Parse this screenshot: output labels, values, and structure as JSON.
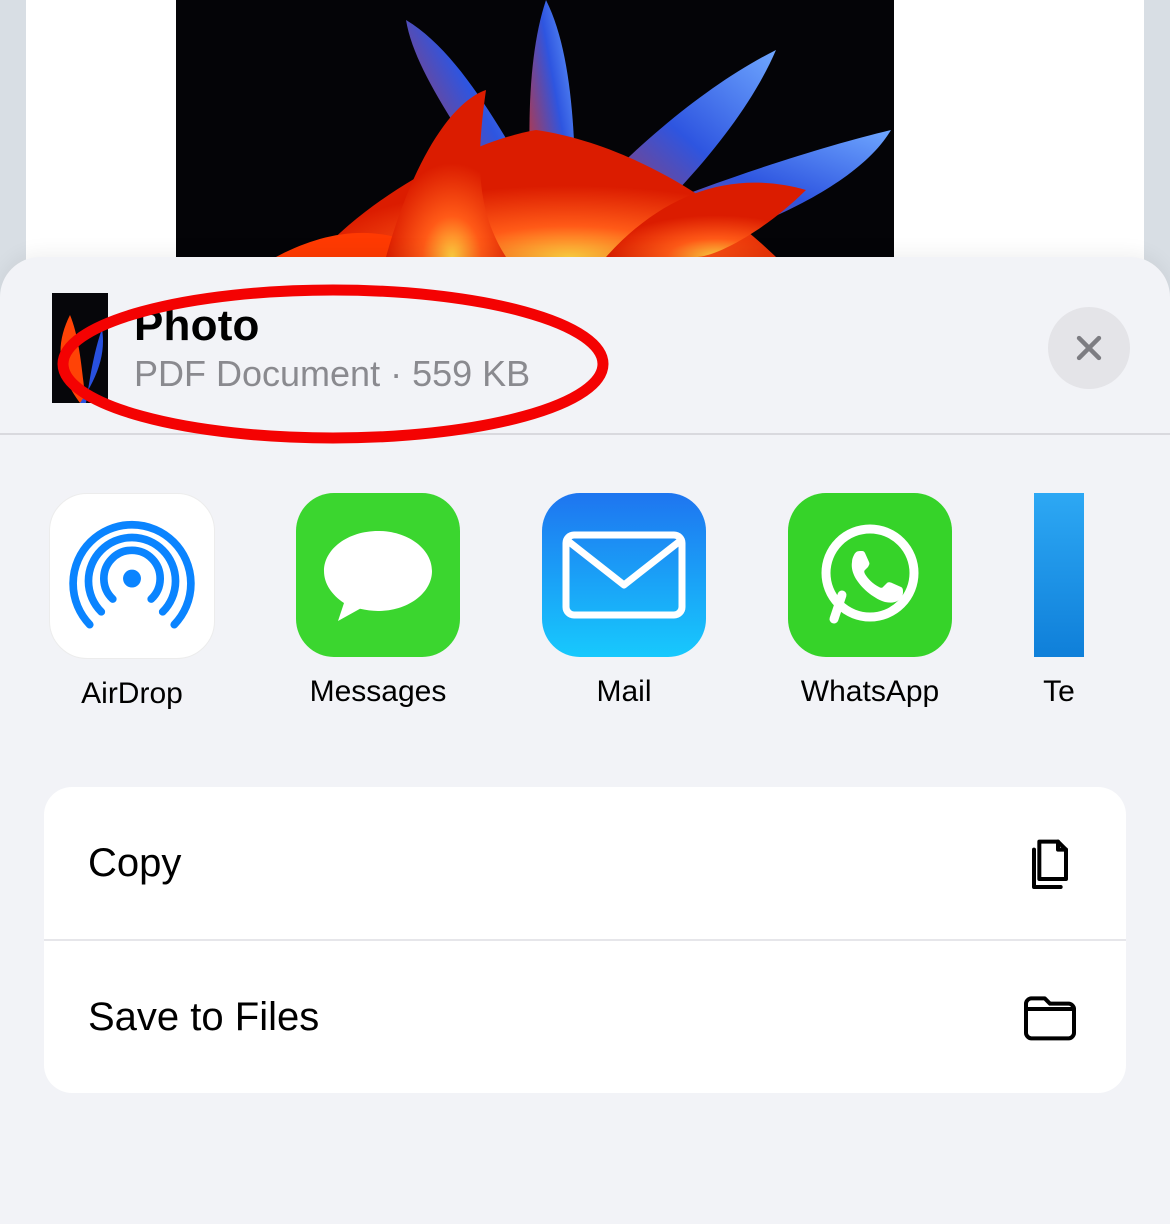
{
  "header": {
    "title": "Photo",
    "subtitle": "PDF Document · 559 KB"
  },
  "apps": [
    {
      "label": "AirDrop"
    },
    {
      "label": "Messages"
    },
    {
      "label": "Mail"
    },
    {
      "label": "WhatsApp"
    },
    {
      "label": "Te"
    }
  ],
  "actions": [
    {
      "label": "Copy"
    },
    {
      "label": "Save to Files"
    }
  ]
}
